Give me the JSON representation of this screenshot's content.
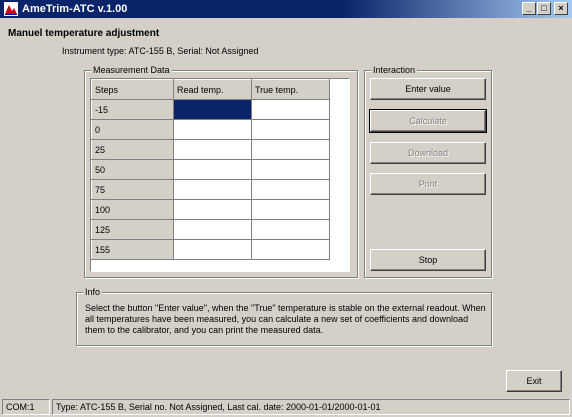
{
  "window": {
    "title": "AmeTrim-ATC v.1.00",
    "controls": {
      "minimize": "_",
      "maximize": "□",
      "close": "×"
    }
  },
  "header": {
    "title": "Manuel temperature adjustment",
    "instrument": "Instrument type: ATC-155 B, Serial: Not Assigned"
  },
  "measurement": {
    "legend": "Measurement Data",
    "columns": [
      "Steps",
      "Read temp.",
      "True temp."
    ],
    "rows": [
      {
        "step": "-15",
        "read": "",
        "true": ""
      },
      {
        "step": "0",
        "read": "",
        "true": ""
      },
      {
        "step": "25",
        "read": "",
        "true": ""
      },
      {
        "step": "50",
        "read": "",
        "true": ""
      },
      {
        "step": "75",
        "read": "",
        "true": ""
      },
      {
        "step": "100",
        "read": "",
        "true": ""
      },
      {
        "step": "125",
        "read": "",
        "true": ""
      },
      {
        "step": "155",
        "read": "",
        "true": ""
      }
    ]
  },
  "interaction": {
    "legend": "Interaction",
    "enter_value": "Enter value",
    "calculate": "Calculate",
    "download": "Download",
    "print": "Print",
    "stop": "Stop"
  },
  "info": {
    "legend": "Info",
    "text": "Select the button \"Enter value\", when the \"True\" temperature is stable on the external readout. When all temperatures have been measured, you can calculate a new set of coefficients and download them to the calibrator, and you can print the measured data."
  },
  "exit_label": "Exit",
  "status": {
    "port": "COM:1",
    "details": "Type: ATC-155 B, Serial no. Not Assigned, Last cal. date: 2000-01-01/2000-01-01"
  },
  "colors": {
    "titlebar": "#0a246a",
    "face": "#d4d0c8",
    "selection": "#0a246a"
  }
}
